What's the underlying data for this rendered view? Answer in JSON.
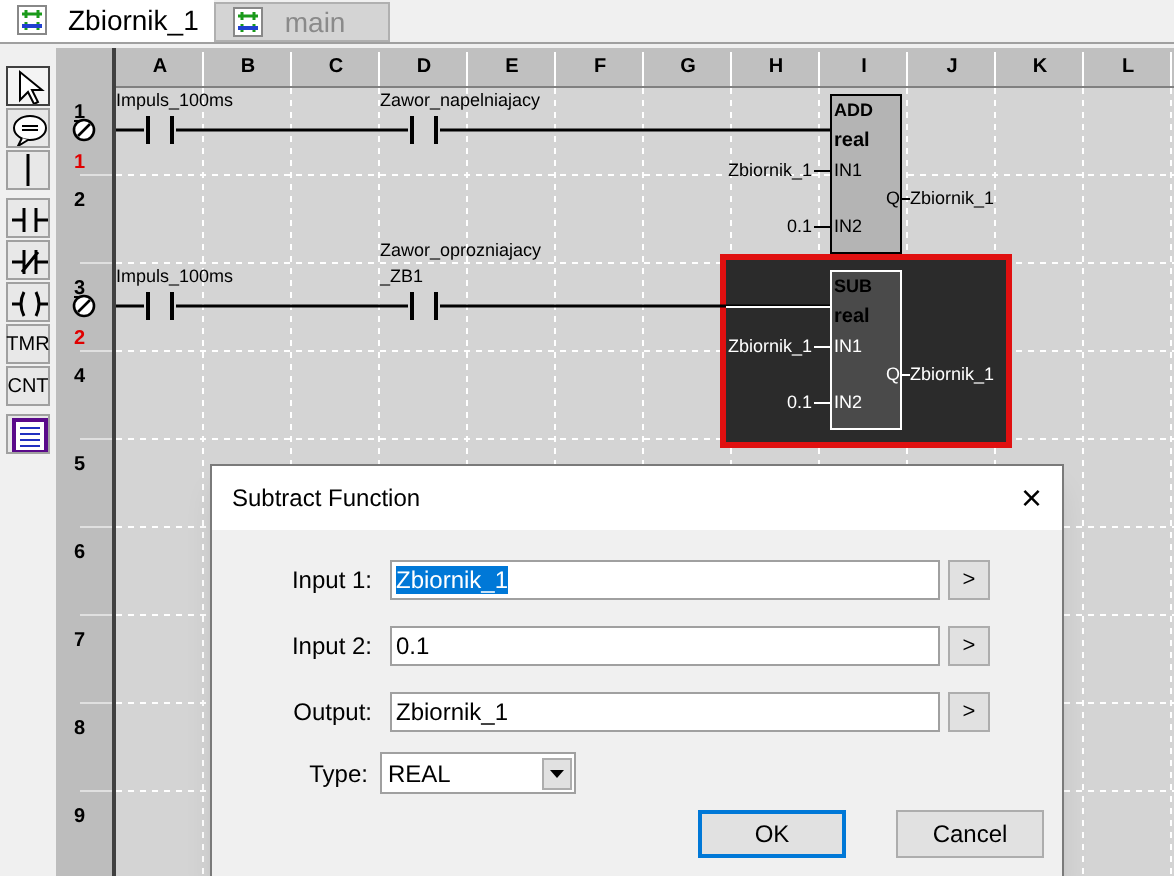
{
  "tabs": [
    {
      "label": "Zbiornik_1",
      "selected": true
    },
    {
      "label": "main",
      "selected": false
    }
  ],
  "toolbar": [
    {
      "kind": "pointer",
      "selected": true
    },
    {
      "kind": "comment",
      "selected": false
    },
    {
      "kind": "line",
      "selected": false
    },
    {
      "kind": "contact",
      "selected": false
    },
    {
      "kind": "nc-contact",
      "selected": false
    },
    {
      "kind": "coil",
      "selected": false
    },
    {
      "kind": "text",
      "label": "TMR",
      "selected": false
    },
    {
      "kind": "text",
      "label": "CNT",
      "selected": false
    },
    {
      "kind": "table",
      "selected": false
    }
  ],
  "columns": [
    "A",
    "B",
    "C",
    "D",
    "E",
    "F",
    "G",
    "H",
    "I",
    "J",
    "K",
    "L"
  ],
  "rows": [
    {
      "label": "1",
      "rung_number": "1",
      "rung": {
        "contacts": [
          {
            "label_lines": [
              "Impuls_100ms"
            ]
          },
          {
            "label_lines": [
              "Zawor_napelniajacy"
            ]
          }
        ],
        "block": {
          "op": "ADD",
          "type": "real",
          "in1": "Zbiornik_1",
          "in1_pin": "IN1",
          "in2": "0.1",
          "in2_pin": "IN2",
          "q_pin": "Q",
          "out": "Zbiornik_1",
          "selected": false
        }
      }
    },
    {
      "label": "2"
    },
    {
      "label": "3",
      "rung_number": "2",
      "rung": {
        "contacts": [
          {
            "label_lines": [
              "Impuls_100ms"
            ]
          },
          {
            "label_lines": [
              "Zawor_oprozniajacy",
              "_ZB1"
            ]
          }
        ],
        "block": {
          "op": "SUB",
          "type": "real",
          "in1": "Zbiornik_1",
          "in1_pin": "IN1",
          "in2": "0.1",
          "in2_pin": "IN2",
          "q_pin": "Q",
          "out": "Zbiornik_1",
          "selected": true
        }
      }
    },
    {
      "label": "4"
    },
    {
      "label": "5"
    },
    {
      "label": "6"
    },
    {
      "label": "7"
    },
    {
      "label": "8"
    },
    {
      "label": "9"
    }
  ],
  "dialog": {
    "title": "Subtract Function",
    "close": "×",
    "fields": [
      {
        "label": "Input 1:",
        "value": "Zbiornik_1",
        "text_selected": true,
        "button": ">"
      },
      {
        "label": "Input 2:",
        "value": "0.1",
        "text_selected": false,
        "button": ">"
      },
      {
        "label": "Output:",
        "value": "Zbiornik_1",
        "text_selected": false,
        "button": ">"
      }
    ],
    "type": {
      "label": "Type:",
      "value": "REAL"
    },
    "buttons": [
      {
        "label": "OK",
        "default": true
      },
      {
        "label": "Cancel",
        "default": false
      }
    ]
  }
}
